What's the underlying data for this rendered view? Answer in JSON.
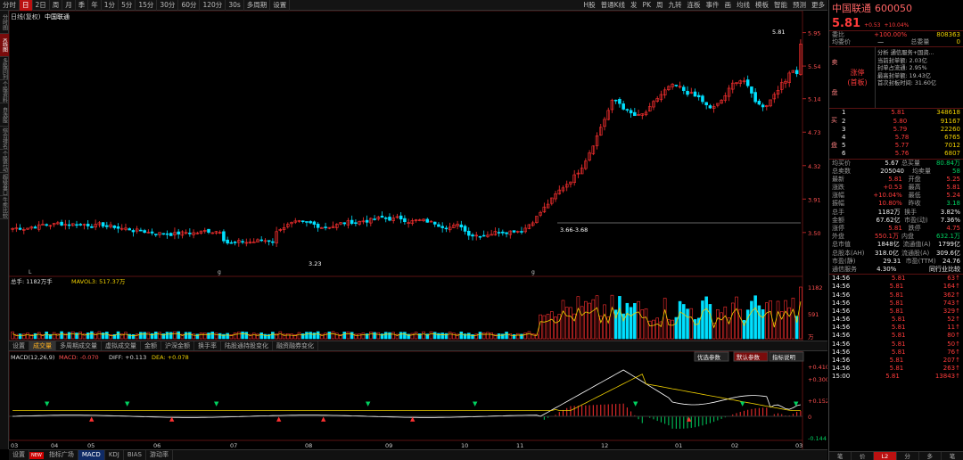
{
  "toolbar": {
    "periods": [
      "分时",
      "日",
      "2日",
      "周",
      "月",
      "季",
      "年",
      "1分",
      "5分",
      "15分",
      "30分",
      "60分",
      "120分",
      "30s",
      "多周期",
      "设置"
    ],
    "active_index": 1,
    "right_items": [
      "H股",
      "普通K线",
      "发",
      "PK",
      "周",
      "九转",
      "连板",
      "事件",
      "画",
      "均线",
      "模板",
      "智能",
      "预测",
      "更多"
    ]
  },
  "leftbar": {
    "items": [
      "分时图",
      "K线图",
      "多股同列",
      "个股资料",
      "自选股",
      "综合排名",
      "个股异动",
      "超级盘口",
      "牛熊比较"
    ],
    "active_index": 1
  },
  "main_chart": {
    "title": "日线(复权)",
    "stock_name": "中国联通",
    "price_ticks": [
      "5.95",
      "5.54",
      "5.14",
      "4.73",
      "4.32",
      "3.91",
      "3.50"
    ],
    "price_axis": [
      5.95,
      5.54,
      5.14,
      4.73,
      4.32,
      3.91,
      3.5
    ],
    "high_label": "5.81",
    "low_label": "3.23",
    "range_label": "3.66-3.68",
    "marker_letters": [
      "L",
      "g",
      "g"
    ]
  },
  "volume_panel": {
    "label_total": "总手: 1182万手",
    "label_mavol": "MAVOL3: 517.37万",
    "ticks": [
      "1182",
      "591",
      "万"
    ]
  },
  "indicator_tabs": {
    "items": [
      "设置",
      "成交量",
      "多周期成交量",
      "虚拟成交量",
      "金额",
      "沪深金额",
      "换手率",
      "陆股通持股变化",
      "融资融券变化"
    ],
    "active_index": 1
  },
  "macd_panel": {
    "title": "MACD(12,26,9)",
    "macd_label": "MACD: -0.070",
    "diff_label": "DIFF: +0.113",
    "dea_label": "DEA: +0.078",
    "buttons": [
      "优选参数",
      "默认参数",
      "指标说明"
    ],
    "active_button": 1,
    "ticks": [
      "+0.410",
      "+0.300",
      "+0.152",
      "0",
      "-0.144"
    ]
  },
  "x_axis": [
    "03",
    "04",
    "05",
    "06",
    "07",
    "08",
    "09",
    "10",
    "11",
    "12",
    "01",
    "02",
    "03"
  ],
  "bottom_tabs": {
    "items": [
      "设置",
      "指标广场",
      "MACD",
      "KDJ",
      "BIAS",
      "游动率"
    ],
    "new_badge": "NEW",
    "active_index": 2
  },
  "right_panel": {
    "name": "中国联通",
    "code": "600050",
    "price": "5.81",
    "change": "+0.53",
    "change_pct": "+10.04%",
    "row1": {
      "k": "委比",
      "v1": "+100.00%",
      "v2": "808363"
    },
    "row2": {
      "k": "均委价",
      "v1": "—",
      "k2": "总委量",
      "v2": "0"
    },
    "limit_badge": "涨停",
    "limit_badge2": "(首板)",
    "limit_vert": [
      "卖",
      "盘"
    ],
    "limit_info": [
      "分析  通信服务+国资...",
      "当前封单额: 2.03亿",
      "封单占流通: 2.95%",
      "最高封单额: 19.43亿",
      "首次封板时间: 31.60亿"
    ],
    "buy_vert": [
      "买",
      "盘"
    ],
    "buys": [
      {
        "lvl": "1",
        "p": "5.81",
        "v": "348618"
      },
      {
        "lvl": "2",
        "p": "5.80",
        "v": "91167"
      },
      {
        "lvl": "3",
        "p": "5.79",
        "v": "22260"
      },
      {
        "lvl": "4",
        "p": "5.78",
        "v": "6765"
      },
      {
        "lvl": "5",
        "p": "5.77",
        "v": "7012"
      },
      {
        "lvl": "6",
        "p": "5.76",
        "v": "6807"
      }
    ],
    "stats": [
      {
        "k1": "均买价",
        "v1": "5.67",
        "k2": "总买量",
        "v2": "80.84万"
      },
      {
        "k1": "总卖数",
        "v1": "205040",
        "k2": "均卖量",
        "v2": "58"
      },
      {
        "k1": "最新",
        "v1": "5.81",
        "k2": "开盘",
        "v2": "5.25"
      },
      {
        "k1": "涨跌",
        "v1": "+0.53",
        "k2": "最高",
        "v2": "5.81"
      },
      {
        "k1": "涨幅",
        "v1": "+10.04%",
        "k2": "最低",
        "v2": "5.24"
      },
      {
        "k1": "振幅",
        "v1": "10.80%",
        "k2": "昨收",
        "v2": "3.18"
      },
      {
        "k1": "总手",
        "v1": "1182万",
        "k2": "换手",
        "v2": "3.82%"
      },
      {
        "k1": "金额",
        "v1": "67.62亿",
        "k2": "市盈(动)",
        "v2": "7.36%"
      },
      {
        "k1": "涨停",
        "v1": "5.81",
        "k2": "跌停",
        "v2": "4.75"
      },
      {
        "k1": "外盘",
        "v1": "550.1万",
        "k2": "内盘",
        "v2": "632.1万"
      },
      {
        "k1": "总市值",
        "v1": "1848亿",
        "k2": "流通值(A)",
        "v2": "1799亿"
      },
      {
        "k1": "总股本(AH)",
        "v1": "318.0亿",
        "k2": "流通股(A)",
        "v2": "309.6亿"
      },
      {
        "k1": "市盈(静)",
        "v1": "29.31",
        "k2": "市盈(TTM)",
        "v2": "24.76"
      },
      {
        "k1": "通信服务",
        "v1": "4.30%",
        "k2": "",
        "v2": "同行业比较"
      }
    ],
    "ticks": [
      {
        "t": "14:56",
        "p": "5.81",
        "v": "63"
      },
      {
        "t": "14:56",
        "p": "5.81",
        "v": "164"
      },
      {
        "t": "14:56",
        "p": "5.81",
        "v": "362"
      },
      {
        "t": "14:56",
        "p": "5.81",
        "v": "743"
      },
      {
        "t": "14:56",
        "p": "5.81",
        "v": "329"
      },
      {
        "t": "14:56",
        "p": "5.81",
        "v": "52"
      },
      {
        "t": "14:56",
        "p": "5.81",
        "v": "11"
      },
      {
        "t": "14:56",
        "p": "5.81",
        "v": "80"
      },
      {
        "t": "14:56",
        "p": "5.81",
        "v": "50"
      },
      {
        "t": "14:56",
        "p": "5.81",
        "v": "76"
      },
      {
        "t": "14:56",
        "p": "5.81",
        "v": "207"
      },
      {
        "t": "14:56",
        "p": "5.81",
        "v": "263"
      },
      {
        "t": "15:00",
        "p": "5.81",
        "v": "13843"
      }
    ],
    "bottom": [
      "笔",
      "价",
      "L2",
      "分",
      "多",
      "笔"
    ],
    "bottom_active": 2
  }
}
